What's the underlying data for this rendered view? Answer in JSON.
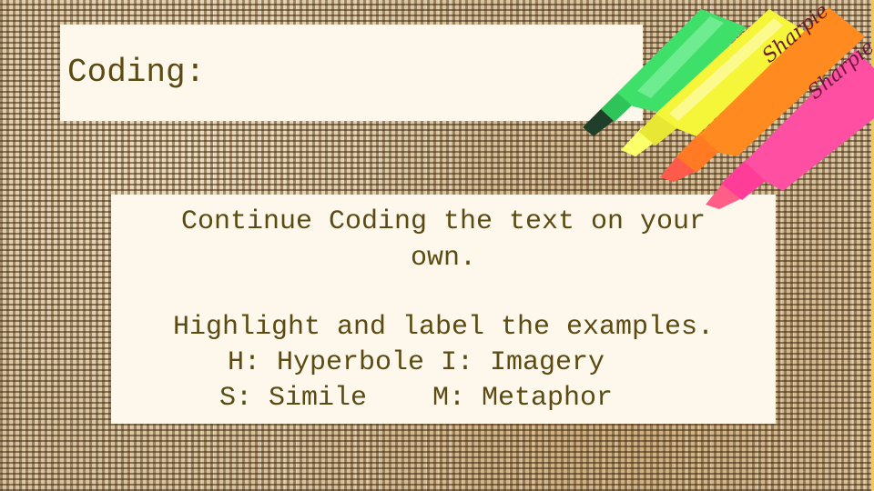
{
  "slide": {
    "title": "Coding:",
    "instructions": [
      "Continue Coding the text on your",
      "own."
    ],
    "task": "Highlight and label the examples.",
    "legend_rows": [
      "H: Hyperbole I: Imagery",
      "S: Simile    M: Metaphor"
    ],
    "legend": [
      {
        "code": "H",
        "label": "Hyperbole"
      },
      {
        "code": "I",
        "label": "Imagery"
      },
      {
        "code": "S",
        "label": "Simile"
      },
      {
        "code": "M",
        "label": "Metaphor"
      }
    ]
  },
  "image": {
    "description": "Four highlighter markers (green, yellow, orange, pink)",
    "brand_text": "Sharpie",
    "colors": {
      "green": "#3ee06a",
      "yellow": "#f5f53a",
      "orange": "#ff8a1f",
      "pink": "#ff4fa3"
    }
  },
  "theme": {
    "text_color": "#5b4a12",
    "panel_color": "#fef8ec",
    "edge_accent": "#f2c94c"
  }
}
